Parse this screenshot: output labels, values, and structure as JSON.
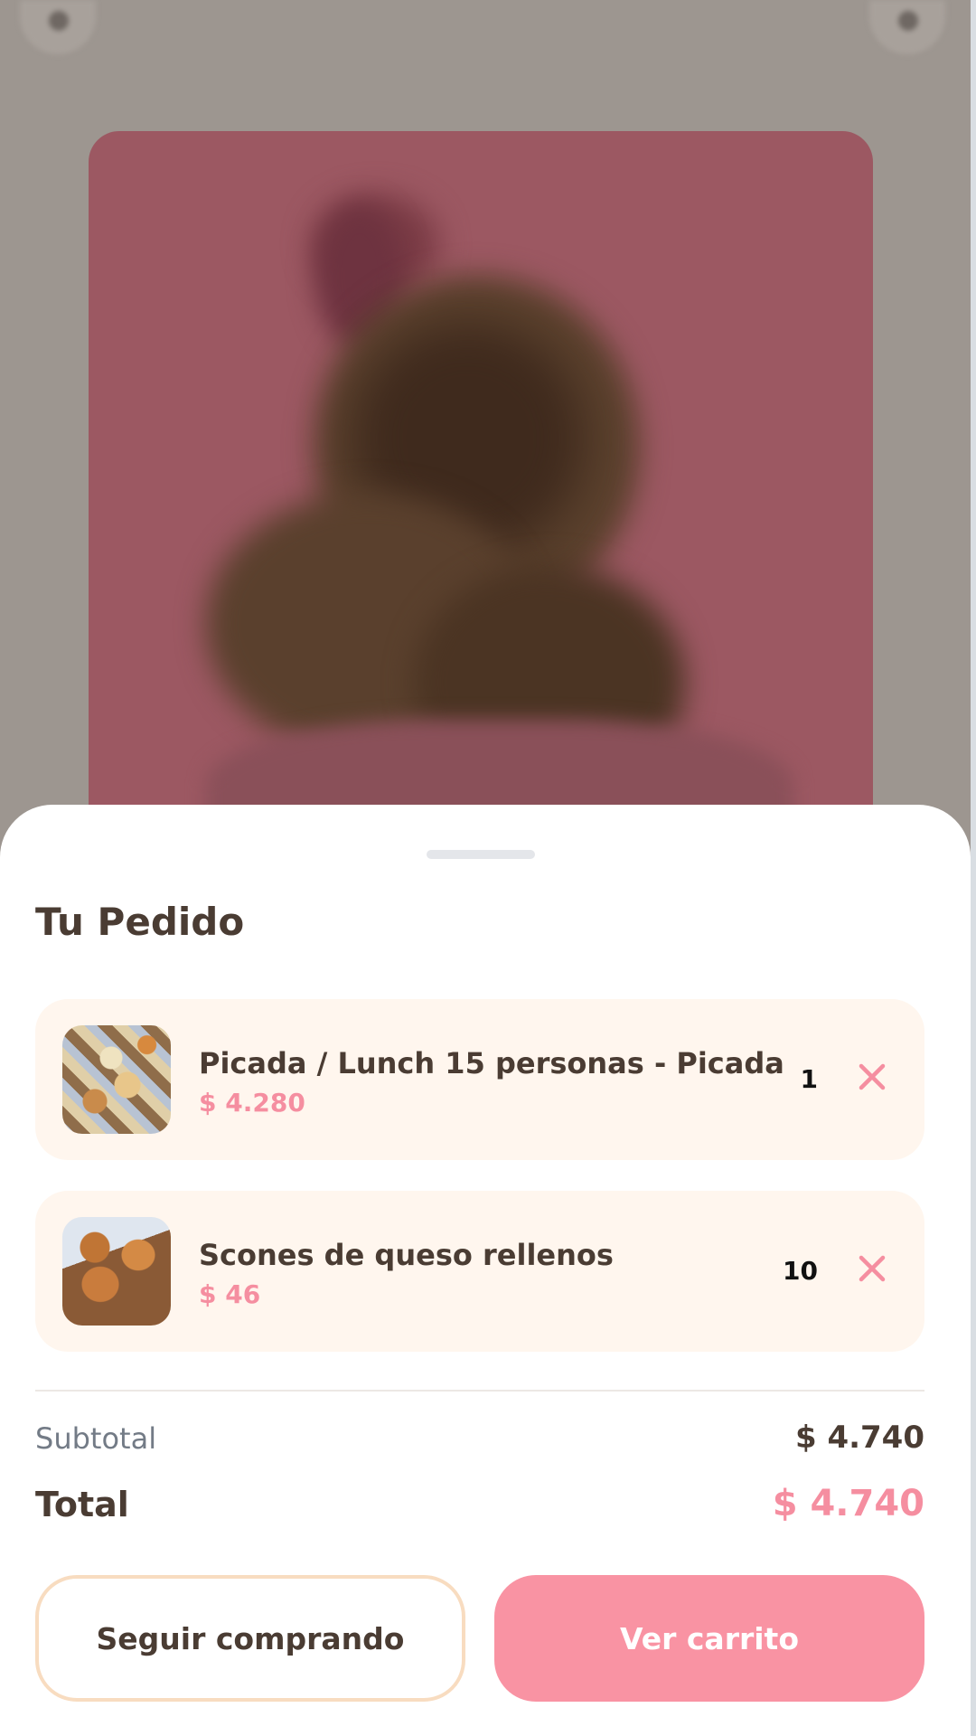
{
  "sheet": {
    "title": "Tu Pedido"
  },
  "items": [
    {
      "name": "Picada / Lunch 15 personas - Picada",
      "price": "$ 4.280",
      "quantity": "1",
      "thumbnail": "picada-lunch-photo"
    },
    {
      "name": "Scones de queso rellenos",
      "price": "$ 46",
      "quantity": "10",
      "thumbnail": "scones-photo"
    }
  ],
  "summary": {
    "subtotal_label": "Subtotal",
    "subtotal_value": "$ 4.740",
    "total_label": "Total",
    "total_value": "$ 4.740"
  },
  "actions": {
    "continue_label": "Seguir comprando",
    "cart_label": "Ver carrito"
  },
  "icons": {
    "remove": "close-icon",
    "back": "back-icon",
    "favorite": "heart-icon"
  },
  "colors": {
    "accent": "#f993a3",
    "price": "#f58ea0",
    "text": "#4a3c33",
    "item_background": "#fff6ee",
    "secondary_border": "#f8dcc0"
  }
}
